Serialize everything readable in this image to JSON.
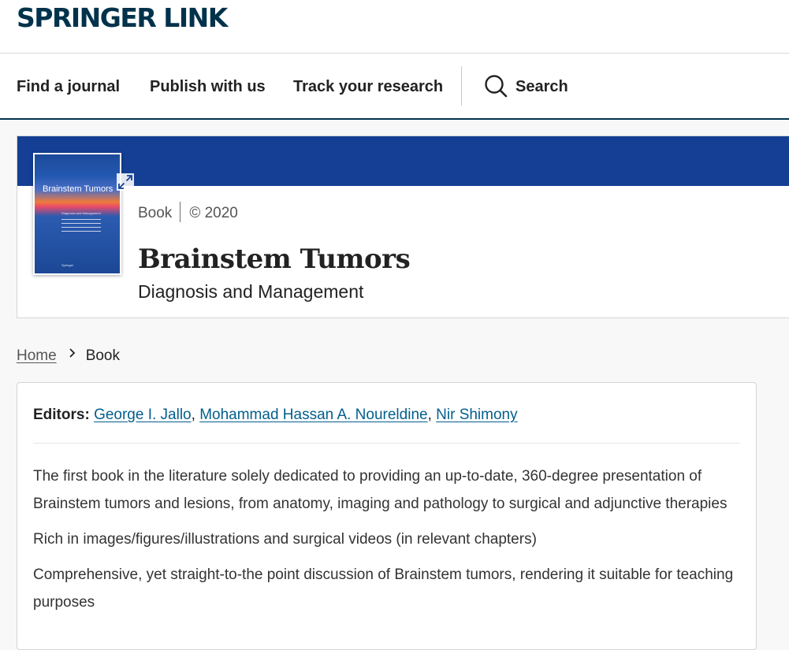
{
  "brand": {
    "logo_text": "SPRINGER LINK",
    "color_primary": "#01324b",
    "color_band": "#143f94",
    "color_link": "#025e8d"
  },
  "nav": {
    "items": [
      {
        "label": "Find a journal"
      },
      {
        "label": "Publish with us"
      },
      {
        "label": "Track your research"
      }
    ],
    "search_label": "Search",
    "search_icon": "search-icon"
  },
  "book": {
    "type": "Book",
    "copyright": "© 2020",
    "title": "Brainstem Tumors",
    "subtitle": "Diagnosis and Management",
    "cover": {
      "title": "Brainstem Tumors",
      "subtitle": "Diagnosis and Management",
      "publisher": "Springer"
    },
    "expand_icon": "expand-icon"
  },
  "breadcrumb": {
    "home": "Home",
    "current": "Book",
    "separator_icon": "chevron-right-icon"
  },
  "content": {
    "editors_label": "Editors:",
    "editors": [
      {
        "name": "George I. Jallo"
      },
      {
        "name": "Mohammad Hassan A. Noureldine"
      },
      {
        "name": "Nir Shimony"
      }
    ],
    "bullets": [
      "The first book in the literature solely dedicated to providing an up-to-date, 360-degree presentation of Brainstem tumors and lesions, from anatomy, imaging and pathology to surgical and adjunctive therapies",
      "Rich in images/figures/illustrations and surgical videos (in relevant chapters)",
      "Comprehensive, yet straight-to-the point discussion of Brainstem tumors, rendering it suitable for teaching purposes"
    ]
  }
}
